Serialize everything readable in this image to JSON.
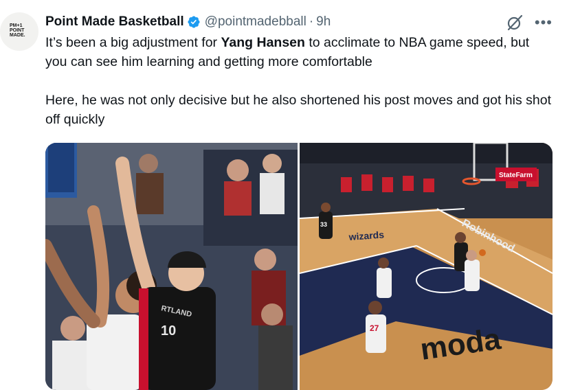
{
  "account": {
    "display_name": "Point Made Basketball",
    "handle": "@pointmadebball",
    "separator": "·",
    "time_ago": "9h",
    "avatar_logo": "PM+1 POINT MADE."
  },
  "icons": {
    "verified": "verified-badge-icon",
    "grok": "grok-icon",
    "more": "more-icon"
  },
  "actions": {
    "more_glyph": "•••"
  },
  "tweet": {
    "para1_pre": "It’s been a big adjustment for ",
    "para1_bold": "Yang Hansen",
    "para1_post": " to acclimate to NBA game speed, but you can see him learning and getting more comfortable",
    "para2": "Here, he was not only decisive but he also shortened his post moves and got his shot off quickly"
  },
  "media": {
    "left_jersey": "10",
    "left_jersey_text": "RTLAND",
    "right_court_logo": "wizards",
    "right_court_brand": "moda",
    "right_banner": "Robinhood",
    "right_sign": "StateFarm",
    "right_player1": "33",
    "right_player2": "27"
  },
  "colors": {
    "verified": "#1d9bf0",
    "secondary_text": "#536471"
  }
}
